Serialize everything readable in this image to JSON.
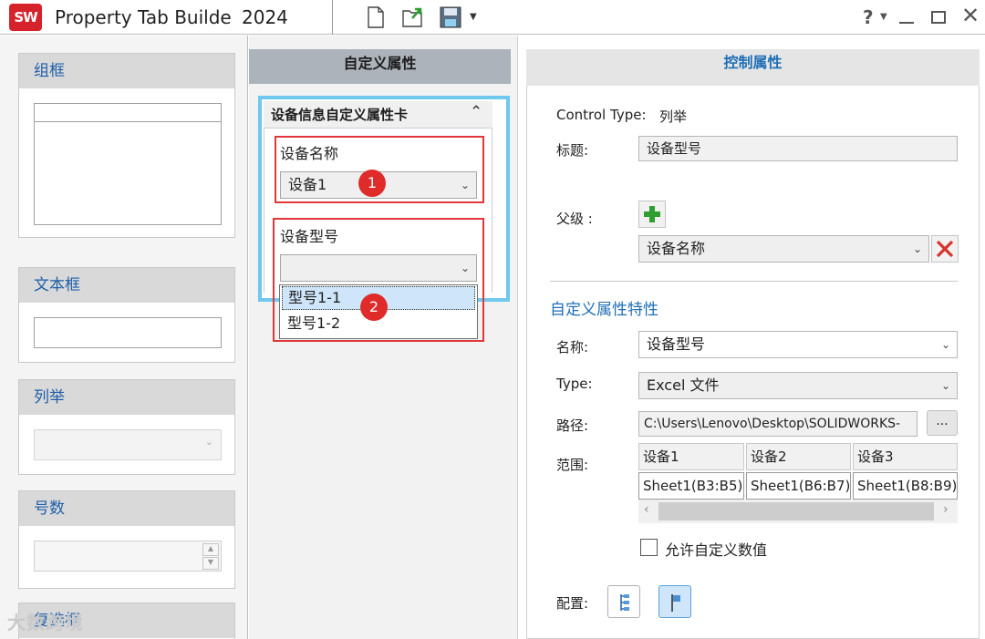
{
  "titlebar": {
    "logo_text": "SW",
    "title": "Property Tab Builde",
    "version": "2024",
    "help": "?"
  },
  "palette": {
    "items": [
      {
        "label": "组框"
      },
      {
        "label": "文本框"
      },
      {
        "label": "列举"
      },
      {
        "label": "号数"
      },
      {
        "label": "复选框"
      }
    ]
  },
  "middle": {
    "header": "自定义属性",
    "card_title": "设备信息自定义属性卡",
    "group1": {
      "label": "设备名称",
      "value": "设备1",
      "badge": "1"
    },
    "group2": {
      "label": "设备型号",
      "value": "",
      "badge": "2"
    },
    "dropdown_options": [
      "型号1-1",
      "型号1-2"
    ]
  },
  "right": {
    "header": "控制属性",
    "control_type_label": "Control Type:",
    "control_type_value": "列举",
    "caption_label": "标题:",
    "caption_value": "设备型号",
    "parent_label": "父级 :",
    "parent_value": "设备名称",
    "section_title": "自定义属性特性",
    "name_label": "名称:",
    "name_value": "设备型号",
    "type_label": "Type:",
    "type_value": "Excel 文件",
    "path_label": "路径:",
    "path_value": "C:\\Users\\Lenovo\\Desktop\\SOLIDWORKS-",
    "browse_label": "...",
    "range_label": "范围:",
    "range_headers": [
      "设备1",
      "设备2",
      "设备3"
    ],
    "range_values": [
      "Sheet1(B3:B5)",
      "Sheet1(B6:B7)",
      "Sheet1(B8:B9)"
    ],
    "allow_custom_label": "允许自定义数值",
    "allow_custom_checked": false,
    "config_label": "配置:"
  },
  "watermark": "大数跨境",
  "colors": {
    "accent_blue": "#1f6fb5",
    "highlight_red": "#e0373b",
    "card_border": "#6fc8ee",
    "add_green": "#2e9e2e",
    "delete_red": "#d9332c"
  }
}
